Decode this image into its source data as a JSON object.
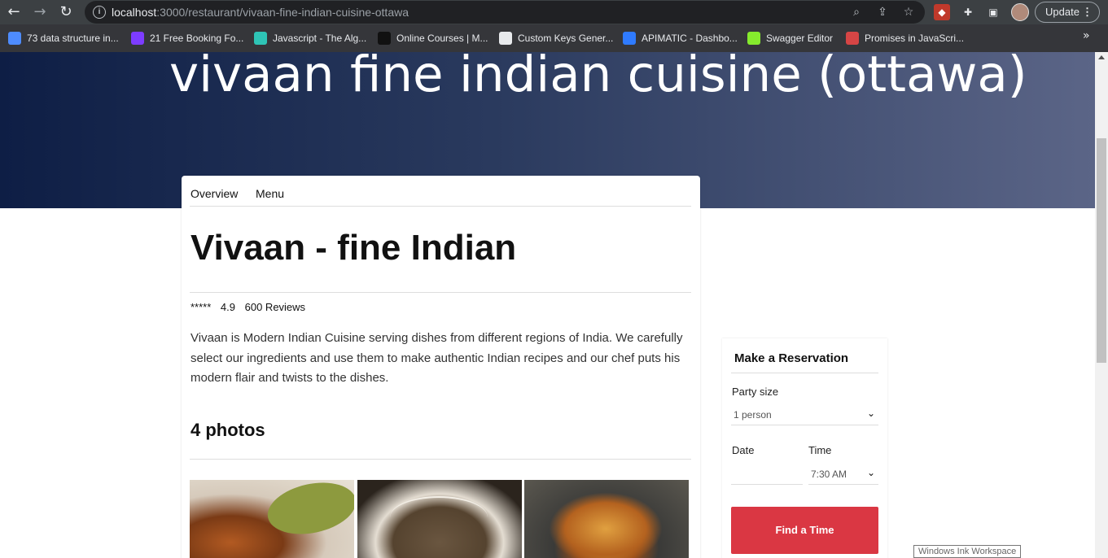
{
  "browser": {
    "url_host": "localhost",
    "url_path": ":3000/restaurant/vivaan-fine-indian-cuisine-ottawa",
    "update_label": "Update",
    "bookmarks": [
      {
        "label": "73 data structure in...",
        "color": "#4e8cff"
      },
      {
        "label": "21 Free Booking Fo...",
        "color": "#7d3cff"
      },
      {
        "label": "Javascript - The Alg...",
        "color": "#2ec4b6"
      },
      {
        "label": "Online Courses | M...",
        "color": "#111111"
      },
      {
        "label": "Custom Keys Gener...",
        "color": "#e8eaed"
      },
      {
        "label": "APIMATIC - Dashbo...",
        "color": "#2f7bff"
      },
      {
        "label": "Swagger Editor",
        "color": "#85ea2d"
      },
      {
        "label": "Promises in JavaScri...",
        "color": "#d64545"
      }
    ]
  },
  "hero": {
    "title": "vivaan fine indian cuisine (ottawa)"
  },
  "tabs": {
    "overview": "Overview",
    "menu": "Menu"
  },
  "restaurant": {
    "name": "Vivaan - fine Indian",
    "stars": "*****",
    "rating": "4.9",
    "reviews": "600 Reviews",
    "description": "Vivaan is Modern Indian Cuisine serving dishes from different regions of India. We carefully select our ingredients and use them to make authentic Indian recipes and our chef puts his modern flair and twists to the dishes.",
    "photos_heading": "4 photos"
  },
  "reservation": {
    "heading": "Make a Reservation",
    "party_label": "Party size",
    "party_value": "1 person",
    "date_label": "Date",
    "time_label": "Time",
    "time_value": "7:30 AM",
    "button": "Find a Time"
  },
  "overlay": {
    "tooltip": "Windows Ink Workspace"
  },
  "colors": {
    "accent": "#da3743",
    "hero_start": "#0e1e45",
    "hero_end": "#5b6587"
  }
}
